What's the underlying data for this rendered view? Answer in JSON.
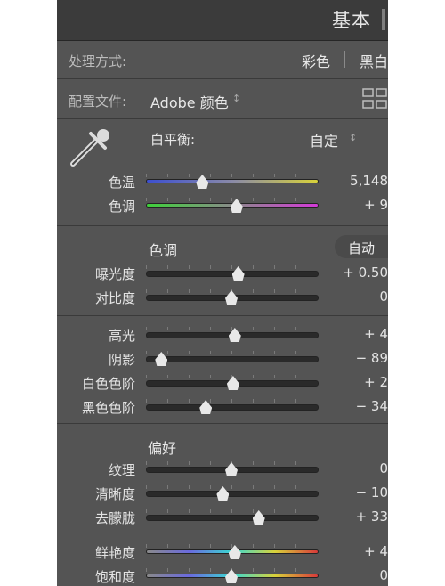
{
  "panel": {
    "title": "基本",
    "treatment": {
      "label": "处理方式:",
      "color": "彩色",
      "bw": "黑白"
    },
    "profile": {
      "label": "配置文件:",
      "value": "Adobe 颜色"
    },
    "white_balance": {
      "label": "白平衡:",
      "value": "自定"
    },
    "tone_header": "色调",
    "auto_button": "自动",
    "presence_header": "偏好",
    "sliders": [
      {
        "label": "色温",
        "value": "5,148",
        "position": 0.33,
        "track": "temp"
      },
      {
        "label": "色调",
        "value": "+ 9",
        "position": 0.53,
        "track": "tint"
      },
      {
        "label": "曝光度",
        "value": "+ 0.50",
        "position": 0.54,
        "track": "plain"
      },
      {
        "label": "对比度",
        "value": "0",
        "position": 0.5,
        "track": "plain"
      },
      {
        "label": "高光",
        "value": "+ 4",
        "position": 0.52,
        "track": "plain"
      },
      {
        "label": "阴影",
        "value": "− 89",
        "position": 0.09,
        "track": "plain"
      },
      {
        "label": "白色色阶",
        "value": "+ 2",
        "position": 0.51,
        "track": "plain"
      },
      {
        "label": "黑色色阶",
        "value": "− 34",
        "position": 0.35,
        "track": "plain"
      },
      {
        "label": "纹理",
        "value": "0",
        "position": 0.5,
        "track": "plain"
      },
      {
        "label": "清晰度",
        "value": "− 10",
        "position": 0.45,
        "track": "plain"
      },
      {
        "label": "去朦胧",
        "value": "+ 33",
        "position": 0.66,
        "track": "plain"
      },
      {
        "label": "鲜艳度",
        "value": "+ 4",
        "position": 0.52,
        "track": "vibrance"
      },
      {
        "label": "饱和度",
        "value": "0",
        "position": 0.5,
        "track": "saturation"
      }
    ]
  },
  "colors": {
    "panel_bg": "#545454",
    "header_bg": "#3b3b3b",
    "text": "#e3e3e3",
    "thumb": "#e8e8e8"
  },
  "icons": [
    "eyedropper-icon",
    "grid-view-icon",
    "up-down-arrows-icon"
  ]
}
